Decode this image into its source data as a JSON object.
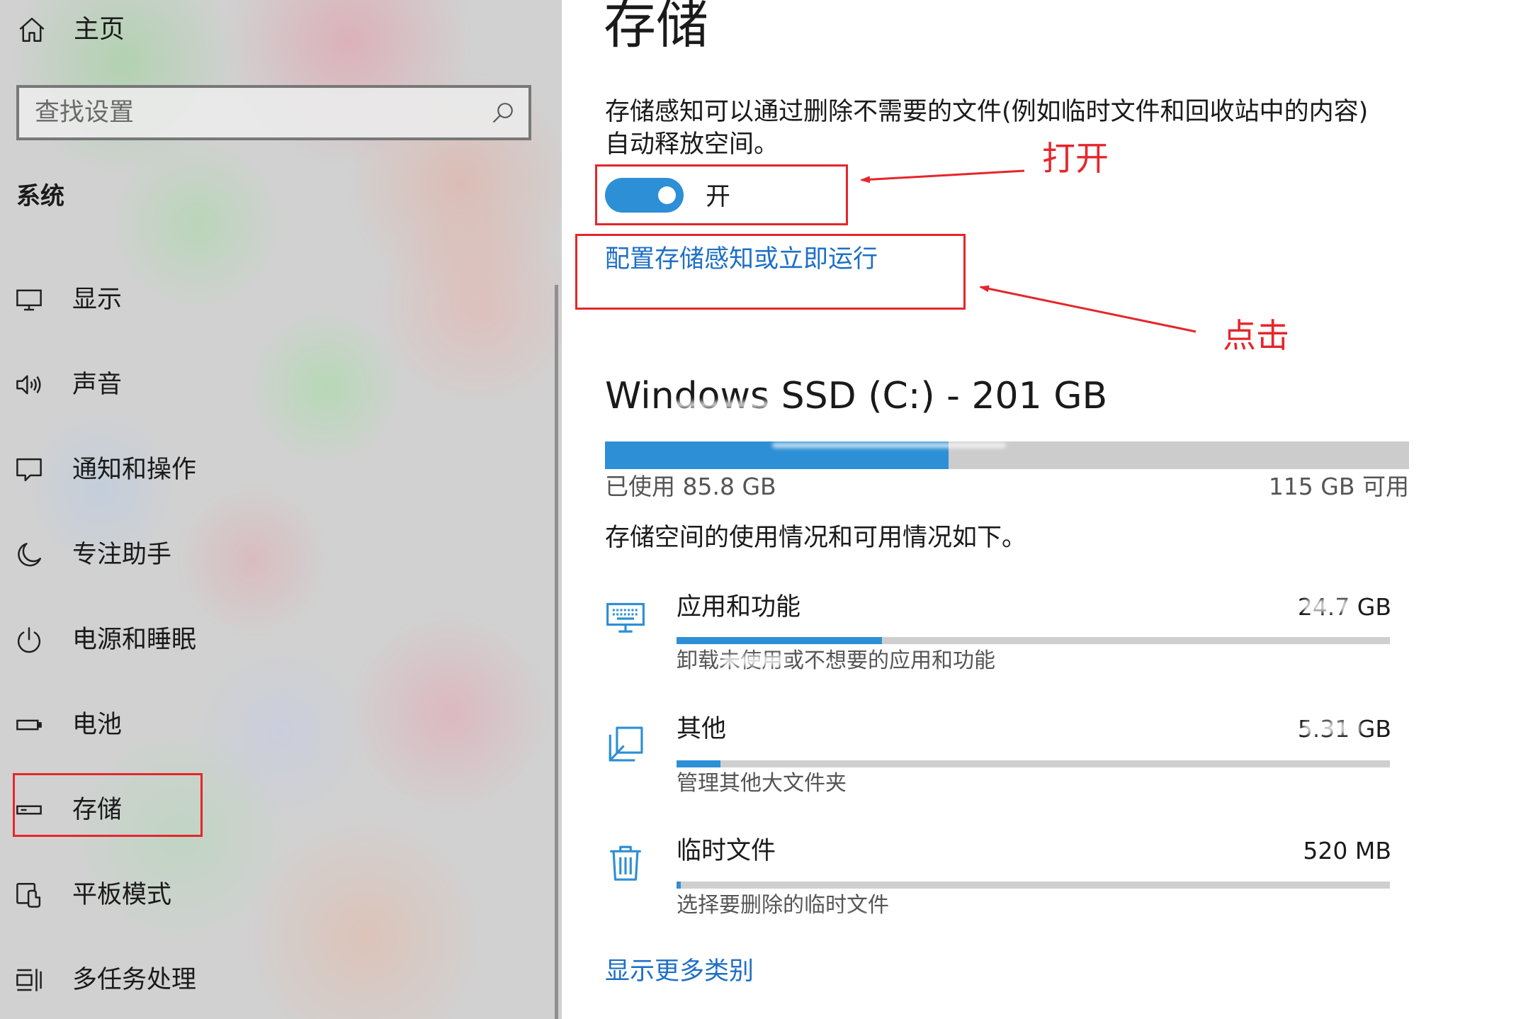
{
  "sidebar": {
    "home_label": "主页",
    "search": {
      "placeholder": "查找设置"
    },
    "section_title": "系统",
    "items": [
      {
        "label": "显示",
        "icon": "monitor-icon"
      },
      {
        "label": "声音",
        "icon": "speaker-icon"
      },
      {
        "label": "通知和操作",
        "icon": "notification-icon"
      },
      {
        "label": "专注助手",
        "icon": "moon-icon"
      },
      {
        "label": "电源和睡眠",
        "icon": "power-icon"
      },
      {
        "label": "电池",
        "icon": "battery-icon"
      },
      {
        "label": "存储",
        "icon": "storage-icon",
        "selected": true
      },
      {
        "label": "平板模式",
        "icon": "tablet-icon"
      },
      {
        "label": "多任务处理",
        "icon": "multitasking-icon"
      }
    ]
  },
  "main": {
    "title": "存储",
    "description_line1": "存储感知可以通过删除不需要的文件(例如临时文件和回收站中的内容)",
    "description_line2": "自动释放空间。",
    "toggle": {
      "on": true,
      "label": "开"
    },
    "configure_link": "配置存储感知或立即运行",
    "drive": {
      "name": "Windows SSD (C:) - 201 GB",
      "used_label": "已使用 85.8 GB",
      "free_label": "115 GB 可用",
      "used_gb": 85.8,
      "free_gb": 115
    },
    "usage_intro": "存储空间的使用情况和可用情况如下。",
    "categories": [
      {
        "title": "应用和功能",
        "size": "24.7 GB",
        "subtitle": "卸载未使用或不想要的应用和功能",
        "usage_fraction": 0.288,
        "icon": "apps-icon"
      },
      {
        "title": "其他",
        "size": "5.31 GB",
        "subtitle": "管理其他大文件夹",
        "usage_fraction": 0.062,
        "icon": "other-folder-icon"
      },
      {
        "title": "临时文件",
        "size": "520 MB",
        "subtitle": "选择要删除的临时文件",
        "usage_fraction": 0.006,
        "icon": "trash-icon"
      }
    ],
    "show_more_link": "显示更多类别"
  },
  "annotations": {
    "turn_on": "打开",
    "click": "点击"
  },
  "colors": {
    "accent": "#2d8fd5",
    "link": "#1f6fc5",
    "annotation": "#e5262b",
    "text": "#1a1a1a"
  }
}
